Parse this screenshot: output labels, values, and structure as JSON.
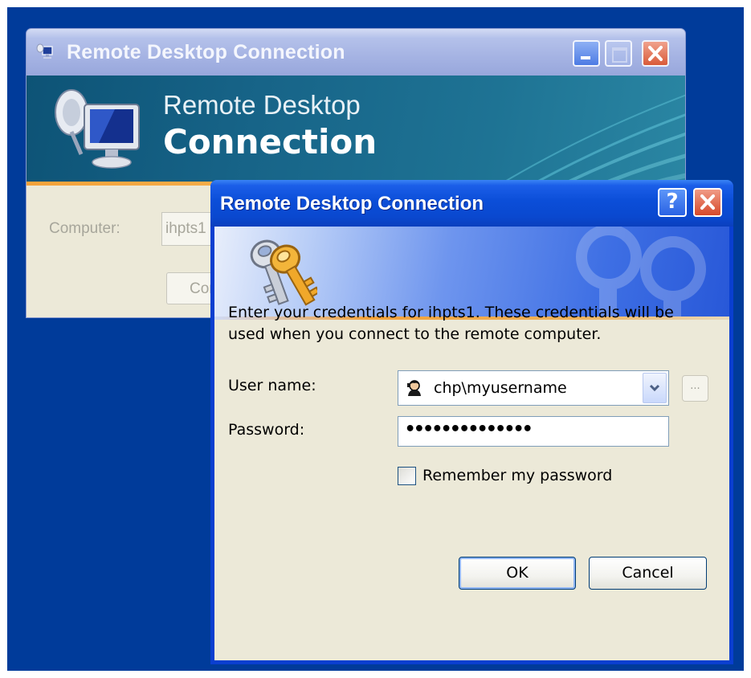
{
  "background_window": {
    "title": "Remote Desktop Connection",
    "banner_line1": "Remote Desktop",
    "banner_line2": "Connection",
    "computer_label": "Computer:",
    "computer_value": "ihpts1",
    "connect_button": "Connect",
    "icons": [
      "remote-desktop-icon",
      "monitor-icon"
    ]
  },
  "dialog": {
    "title": "Remote Desktop Connection",
    "help_button": "?",
    "message": "Enter your credentials for ihpts1. These credentials will be used when you connect to the remote computer.",
    "username_label": "User name:",
    "username_value": "chp\\myusername",
    "password_label": "Password:",
    "password_mask": "••••••••••••••",
    "remember_label": "Remember my password",
    "remember_checked": false,
    "browse_button": "...",
    "ok_button": "OK",
    "cancel_button": "Cancel",
    "icons": [
      "keys-icon",
      "user-icon",
      "chevron-down-icon",
      "help-icon",
      "close-icon"
    ]
  },
  "colors": {
    "desktop": "#003b9a",
    "dialog_titlebar": "#0a48cf",
    "dialog_body": "#ece9d8",
    "close_button": "#d6492a",
    "accent_orange": "#f4a23a"
  }
}
